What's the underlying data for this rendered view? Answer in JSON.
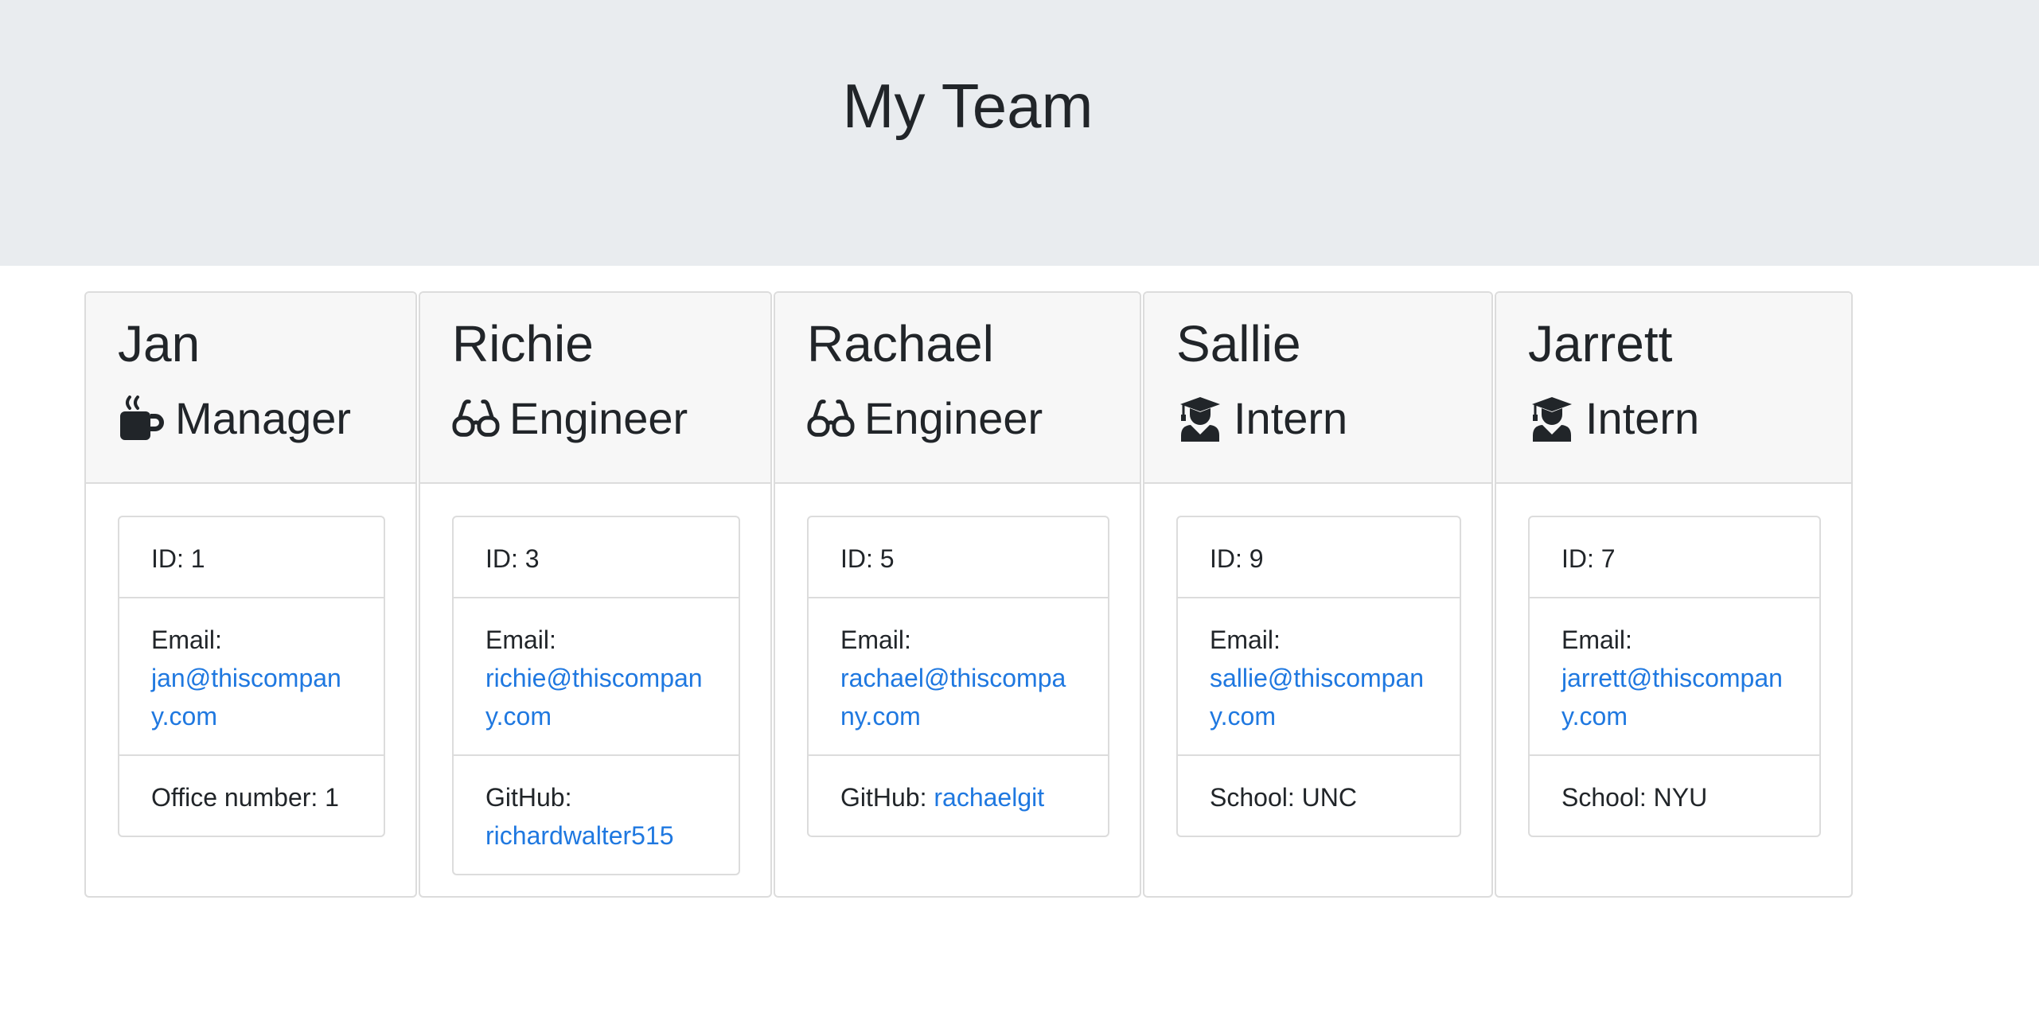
{
  "header": {
    "title": "My Team"
  },
  "colors": {
    "link": "#1f78e0",
    "header_bg": "#e9ecef",
    "card_header_bg": "#f7f7f7"
  },
  "employees": [
    {
      "name": "Jan",
      "role": "Manager",
      "icon": "mug-icon",
      "id_label": "ID: 1",
      "email_label": "Email:",
      "email": "jan@thiscompany.com",
      "extra_label": "Office number: 1",
      "extra_link": ""
    },
    {
      "name": "Richie",
      "role": "Engineer",
      "icon": "glasses-icon",
      "id_label": "ID: 3",
      "email_label": "Email:",
      "email": "richie@thiscompany.com",
      "extra_label": "GitHub:",
      "extra_link": "richardwalter515"
    },
    {
      "name": "Rachael",
      "role": "Engineer",
      "icon": "glasses-icon",
      "id_label": "ID: 5",
      "email_label": "Email:",
      "email": "rachael@thiscompany.com",
      "extra_label": "GitHub:",
      "extra_link": "rachaelgit"
    },
    {
      "name": "Sallie",
      "role": "Intern",
      "icon": "graduate-icon",
      "id_label": "ID: 9",
      "email_label": "Email:",
      "email": "sallie@thiscompany.com",
      "extra_label": "School: UNC",
      "extra_link": ""
    },
    {
      "name": "Jarrett",
      "role": "Intern",
      "icon": "graduate-icon",
      "id_label": "ID: 7",
      "email_label": "Email:",
      "email": "jarrett@thiscompany.com",
      "extra_label": "School: NYU",
      "extra_link": ""
    }
  ]
}
